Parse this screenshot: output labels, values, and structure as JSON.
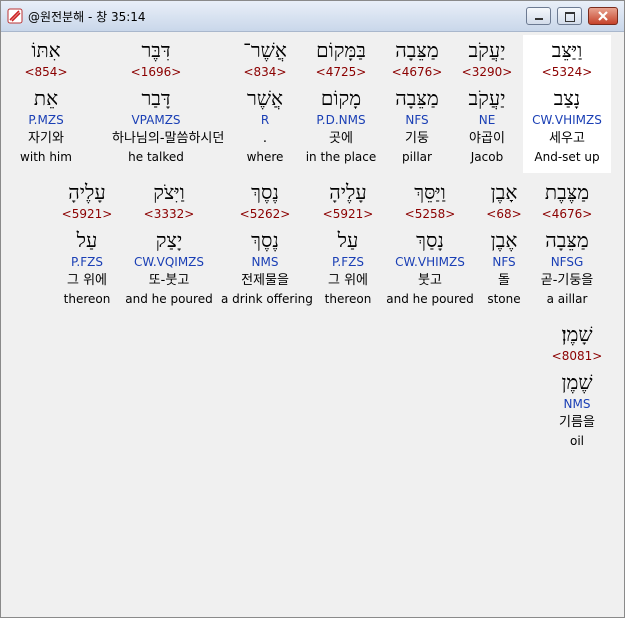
{
  "window": {
    "title": "@원전분해 - 창 35:14"
  },
  "rows": [
    [
      {
        "heb": "וַיַּצֵּב",
        "num": "<5324>",
        "lemma": "נָצַב",
        "parse": "CW.VHIMZS",
        "kor": "세우고",
        "eng": "And-set up",
        "selected": true
      },
      {
        "heb": "יַעֲקֹב",
        "num": "<3290>",
        "lemma": "יַעֲקֹב",
        "parse": "NE",
        "kor": "야곱이",
        "eng": "Jacob"
      },
      {
        "heb": "מַצֵּבָה",
        "num": "<4676>",
        "lemma": "מַצֵּבָה",
        "parse": "NFS",
        "kor": "기둥",
        "eng": "pillar"
      },
      {
        "heb": "בַּמָּקוֹם",
        "num": "<4725>",
        "lemma": "מָקוֹם",
        "parse": "P.D.NMS",
        "kor": "곳에",
        "eng": "in the place"
      },
      {
        "heb": "אֲשֶׁר־",
        "num": "<834>",
        "lemma": "אֲשֶׁר",
        "parse": "R",
        "kor": ".",
        "eng": "where"
      },
      {
        "heb": "דִּבֶּר",
        "num": "<1696>",
        "lemma": "דָּבַר",
        "parse": "VPAMZS",
        "kor": "하나님의-말씀하시던",
        "eng": "he talked"
      },
      {
        "heb": "אִתּוֹ",
        "num": "<854>",
        "lemma": "אֵת",
        "parse": "P.MZS",
        "kor": "자기와",
        "eng": "with him"
      }
    ],
    [
      {
        "heb": "מַצֶּבֶת",
        "num": "<4676>",
        "lemma": "מַצֵּבָה",
        "parse": "NFSG",
        "kor": "곧-기둥을",
        "eng": "a aillar"
      },
      {
        "heb": "אָבֶן",
        "num": "<68>",
        "lemma": "אֶבֶן",
        "parse": "NFS",
        "kor": "돌",
        "eng": "stone"
      },
      {
        "heb": "וַיַּסֵּךְ",
        "num": "<5258>",
        "lemma": "נָסַךְ",
        "parse": "CW.VHIMZS",
        "kor": "붓고",
        "eng": "and he poured"
      },
      {
        "heb": "עָלֶיהָ",
        "num": "<5921>",
        "lemma": "עַל",
        "parse": "P.FZS",
        "kor": "그 위에",
        "eng": "thereon"
      },
      {
        "heb": "נֶסֶךְ",
        "num": "<5262>",
        "lemma": "נֶסֶךְ",
        "parse": "NMS",
        "kor": "전제물을",
        "eng": "a drink offering"
      },
      {
        "heb": "וַיִּצֹק",
        "num": "<3332>",
        "lemma": "יָצַק",
        "parse": "CW.VQIMZS",
        "kor": "또-붓고",
        "eng": "and he poured"
      },
      {
        "heb": "עָלֶיהָ",
        "num": "<5921>",
        "lemma": "עַל",
        "parse": "P.FZS",
        "kor": "그 위에",
        "eng": "thereon"
      }
    ],
    [
      {
        "heb": "שָׁמֶן׃",
        "num": "<8081>",
        "lemma": "שֶׁמֶן",
        "parse": "NMS",
        "kor": "기름을",
        "eng": "oil"
      }
    ]
  ]
}
